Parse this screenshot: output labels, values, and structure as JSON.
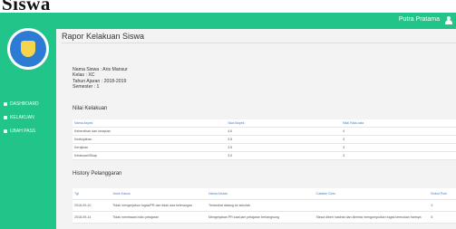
{
  "heading": "Siswa",
  "topbar": {
    "user_name": "Putra Pratama"
  },
  "sidebar": {
    "items": [
      {
        "label": "DASHBOARD",
        "icon": "dashboard-icon"
      },
      {
        "label": "KELAKUAN",
        "icon": "gear-icon"
      },
      {
        "label": "UBAH PASS",
        "icon": "wrench-icon"
      }
    ]
  },
  "main": {
    "title": "Rapor Kelakuan Siswa",
    "info": [
      {
        "label": "Nama Siswa",
        "value": ": Aris Mansur"
      },
      {
        "label": "Kelas",
        "value": ": XC"
      },
      {
        "label": "Tahun Ajaran",
        "value": ": 2018-2019"
      },
      {
        "label": "Semester",
        "value": ": 1"
      }
    ],
    "nilai_title": "Nilai Kelakuan",
    "nilai_table": {
      "headers": [
        "Nama Aspek",
        "Skor/Aspek",
        "Nilai Rata-rata"
      ],
      "rows": [
        [
          "Kebersihan dan kerapian",
          "4.0",
          "4"
        ],
        [
          "Kedisiplinan",
          "3.5",
          "3"
        ],
        [
          "Kerajinan",
          "3.5",
          "3"
        ],
        [
          "Kelakuan/Sikap",
          "3.0",
          "3"
        ]
      ]
    },
    "history_title": "History Pelanggaran",
    "history_table": {
      "headers": [
        "Tgl",
        "Jenis Kasus",
        "Nama Aturan",
        "Catatan Guru",
        "Bobot Poin"
      ],
      "rows": [
        [
          "2018-09-10",
          "Tidak mengerjakan tugas/PR dan tidak ada keterangan",
          "Terlambat datang ke sekolah",
          "",
          "3"
        ],
        [
          "2018-09-14",
          "Tidak membawa buku pelajaran",
          "Mengerjakan PR saat jam pelajaran berlangsung",
          "Siswa diberi nasihat dan diminta mengumpulkan tugas keesokan harinya",
          "5"
        ]
      ]
    }
  }
}
